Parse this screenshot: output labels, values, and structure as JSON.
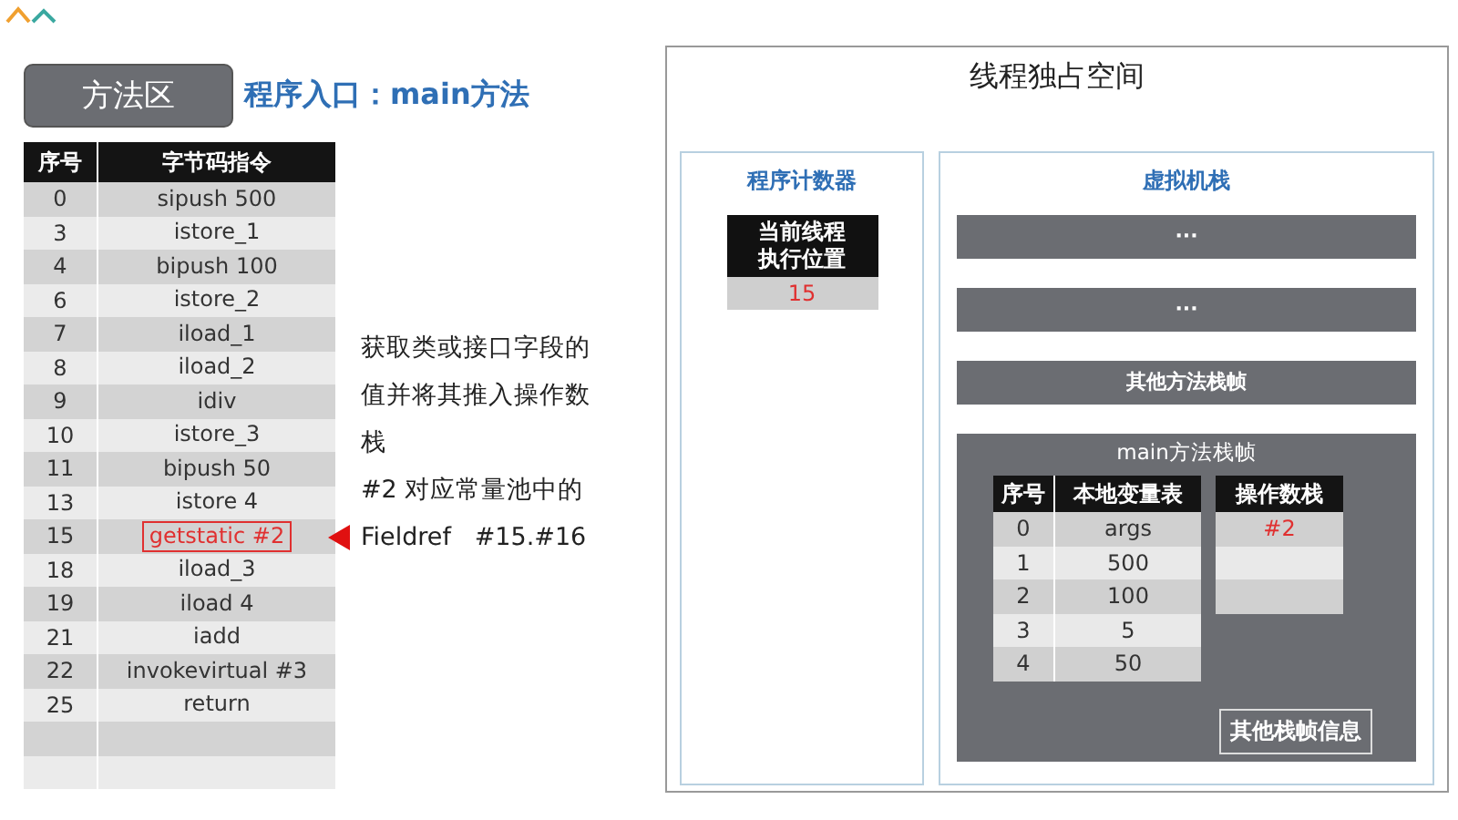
{
  "method_area": {
    "label": "方法区",
    "title": "程序入口：main方法"
  },
  "bytecode_table": {
    "columns": [
      "序号",
      "字节码指令"
    ],
    "rows": [
      {
        "index": "0",
        "instruction": "sipush 500",
        "highlighted": false
      },
      {
        "index": "3",
        "instruction": "istore_1",
        "highlighted": false
      },
      {
        "index": "4",
        "instruction": "bipush 100",
        "highlighted": false
      },
      {
        "index": "6",
        "instruction": "istore_2",
        "highlighted": false
      },
      {
        "index": "7",
        "instruction": "iload_1",
        "highlighted": false
      },
      {
        "index": "8",
        "instruction": "iload_2",
        "highlighted": false
      },
      {
        "index": "9",
        "instruction": "idiv",
        "highlighted": false
      },
      {
        "index": "10",
        "instruction": "istore_3",
        "highlighted": false
      },
      {
        "index": "11",
        "instruction": "bipush 50",
        "highlighted": false
      },
      {
        "index": "13",
        "instruction": "istore 4",
        "highlighted": false
      },
      {
        "index": "15",
        "instruction": "getstatic #2",
        "highlighted": true
      },
      {
        "index": "18",
        "instruction": "iload_3",
        "highlighted": false
      },
      {
        "index": "19",
        "instruction": "iload 4",
        "highlighted": false
      },
      {
        "index": "21",
        "instruction": "iadd",
        "highlighted": false
      },
      {
        "index": "22",
        "instruction": "invokevirtual #3",
        "highlighted": false
      },
      {
        "index": "25",
        "instruction": "return",
        "highlighted": false
      }
    ]
  },
  "note": {
    "lines": [
      "获取类或接口字段的值并将其推入操作数栈",
      "#2 对应常量池中的",
      "Fieldref   #15.#16"
    ]
  },
  "thread_space": {
    "title": "线程独占空间",
    "program_counter": {
      "title": "程序计数器",
      "label_lines": [
        "当前线程",
        "执行位置"
      ],
      "value": "15"
    },
    "vm_stack": {
      "title": "虚拟机栈",
      "frames": [
        {
          "label": "···"
        },
        {
          "label": "···"
        },
        {
          "label": "其他方法栈帧"
        }
      ],
      "main_frame": {
        "title": "main方法栈帧",
        "locals": {
          "columns": [
            "序号",
            "本地变量表"
          ],
          "rows": [
            [
              "0",
              "args"
            ],
            [
              "1",
              "500"
            ],
            [
              "2",
              "100"
            ],
            [
              "3",
              "5"
            ],
            [
              "4",
              "50"
            ]
          ]
        },
        "operand_stack": {
          "title": "操作数栈",
          "slots": [
            "#2"
          ]
        },
        "other_info": "其他栈帧信息"
      }
    }
  }
}
